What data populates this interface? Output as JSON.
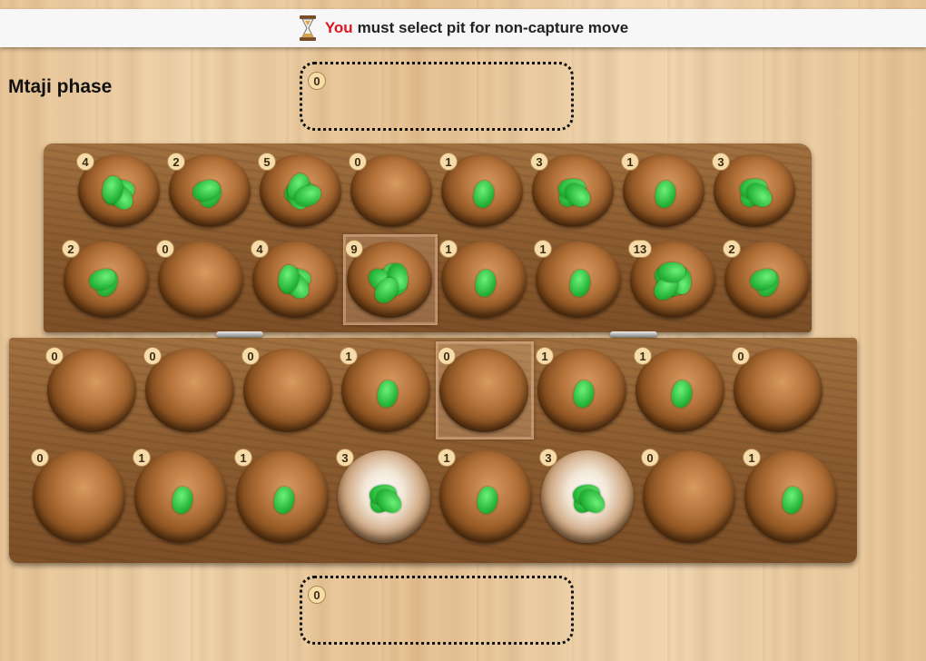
{
  "status": {
    "player": "You",
    "message": "must select pit for non-capture move",
    "icon": "hourglass-icon"
  },
  "phase": "Mtaji phase",
  "stores": {
    "top": 0,
    "bottom": 0
  },
  "board": {
    "rows": [
      [
        4,
        2,
        5,
        0,
        1,
        3,
        1,
        3
      ],
      [
        2,
        0,
        4,
        9,
        1,
        1,
        13,
        2
      ],
      [
        0,
        0,
        0,
        1,
        0,
        1,
        1,
        0
      ],
      [
        0,
        1,
        1,
        3,
        1,
        3,
        0,
        1
      ]
    ],
    "framed_pits": [
      [
        1,
        3
      ],
      [
        2,
        4
      ]
    ],
    "highlighted_pits": [
      [
        3,
        3
      ],
      [
        3,
        5
      ]
    ]
  },
  "colors": {
    "seed": "#2fc040",
    "player_name": "#e0141c",
    "status_bar": "#f7f7f7"
  }
}
